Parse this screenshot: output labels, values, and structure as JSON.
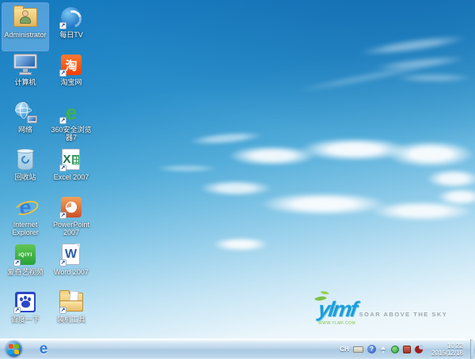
{
  "desktop": {
    "icons": [
      {
        "label": "Administrator",
        "selected": true
      },
      {
        "label": "计算机",
        "selected": false
      },
      {
        "label": "网络",
        "selected": false
      },
      {
        "label": "回收站",
        "selected": false
      },
      {
        "label": "Internet Explorer",
        "selected": false
      },
      {
        "label": "爱奇艺视频",
        "selected": false
      },
      {
        "label": "百度一下",
        "selected": false
      },
      {
        "label": "每日TV",
        "selected": false
      },
      {
        "label": "淘宝网",
        "selected": false
      },
      {
        "label": "360安全浏览器7",
        "selected": false
      },
      {
        "label": "Excel 2007",
        "selected": false
      },
      {
        "label": "PowerPoint 2007",
        "selected": false
      },
      {
        "label": "Word 2007",
        "selected": false
      },
      {
        "label": "装机工具",
        "selected": false
      }
    ],
    "watermark": {
      "logo": "ylmf",
      "url": "WWW.YLMF.COM",
      "slogan": "SOAR ABOVE THE SKY"
    }
  },
  "glyphs": {
    "taobao": "淘",
    "excel": "X",
    "word": "W",
    "ie": "e",
    "browser360": "e",
    "iqiyi": "iQIYI",
    "shortcut_arrow": "↗",
    "help": "?"
  },
  "taskbar": {
    "tray": {
      "language": "CH",
      "time": "10:22",
      "date": "2015/12/18"
    }
  },
  "colors": {
    "sky_top": "#1478be",
    "sky_bottom": "#f4fafd",
    "taskbar": "#bcd5ea",
    "selection": "#96cdf8",
    "logo_blue": "#1d9ed9",
    "logo_green": "#7dc242"
  }
}
